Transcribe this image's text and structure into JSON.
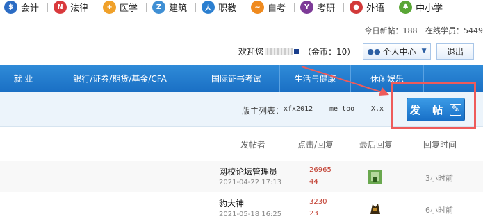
{
  "topnav": [
    {
      "label": "会计",
      "icon": "accounting-icon",
      "color": "#2b6cc4",
      "glyph": "$"
    },
    {
      "label": "法律",
      "icon": "law-icon",
      "color": "#d9393c",
      "glyph": "N"
    },
    {
      "label": "医学",
      "icon": "medical-icon",
      "color": "#f0a12a",
      "glyph": "+"
    },
    {
      "label": "建筑",
      "icon": "construction-icon",
      "color": "#3f8fd4",
      "glyph": "Z"
    },
    {
      "label": "职教",
      "icon": "vocational-icon",
      "color": "#2b7fd0",
      "glyph": "人"
    },
    {
      "label": "自考",
      "icon": "self-study-icon",
      "color": "#ef8a1e",
      "glyph": "~"
    },
    {
      "label": "考研",
      "icon": "graduate-icon",
      "color": "#7d3a97",
      "glyph": "Y"
    },
    {
      "label": "外语",
      "icon": "language-icon",
      "color": "#d23a3a",
      "glyph": "●"
    },
    {
      "label": "中小学",
      "icon": "school-icon",
      "color": "#5aa636",
      "glyph": "♣"
    }
  ],
  "stats": {
    "today_posts": "今日新帖：188",
    "online": "在线学员：5449"
  },
  "user": {
    "welcome": "欢迎您",
    "coins": "（金币：10）",
    "center": "个人中心",
    "logout": "退出"
  },
  "mainnav": [
    "就 业",
    "银行/证券/期货/基金/CFA",
    "国际证书考试",
    "生活与健康",
    "休闲娱乐"
  ],
  "moderators": {
    "label": "版主列表：",
    "names": [
      "xfx2012",
      "me too",
      "X.x"
    ]
  },
  "post_button": "发 帖",
  "table": {
    "headers": [
      "发帖者",
      "点击/回复",
      "最后回复",
      "回复时间"
    ],
    "rows": [
      {
        "author": "网校论坛管理员",
        "date": "2021-04-22 17:13",
        "clicks": "26965",
        "replies": "44",
        "time": "3小时前"
      },
      {
        "author": "豹大神",
        "date": "2021-05-18 16:25",
        "clicks": "3230",
        "replies": "23",
        "time": "6小时前"
      }
    ]
  },
  "colors": {
    "accent": "#1a6fc4",
    "highlight": "#ee5b5b"
  }
}
